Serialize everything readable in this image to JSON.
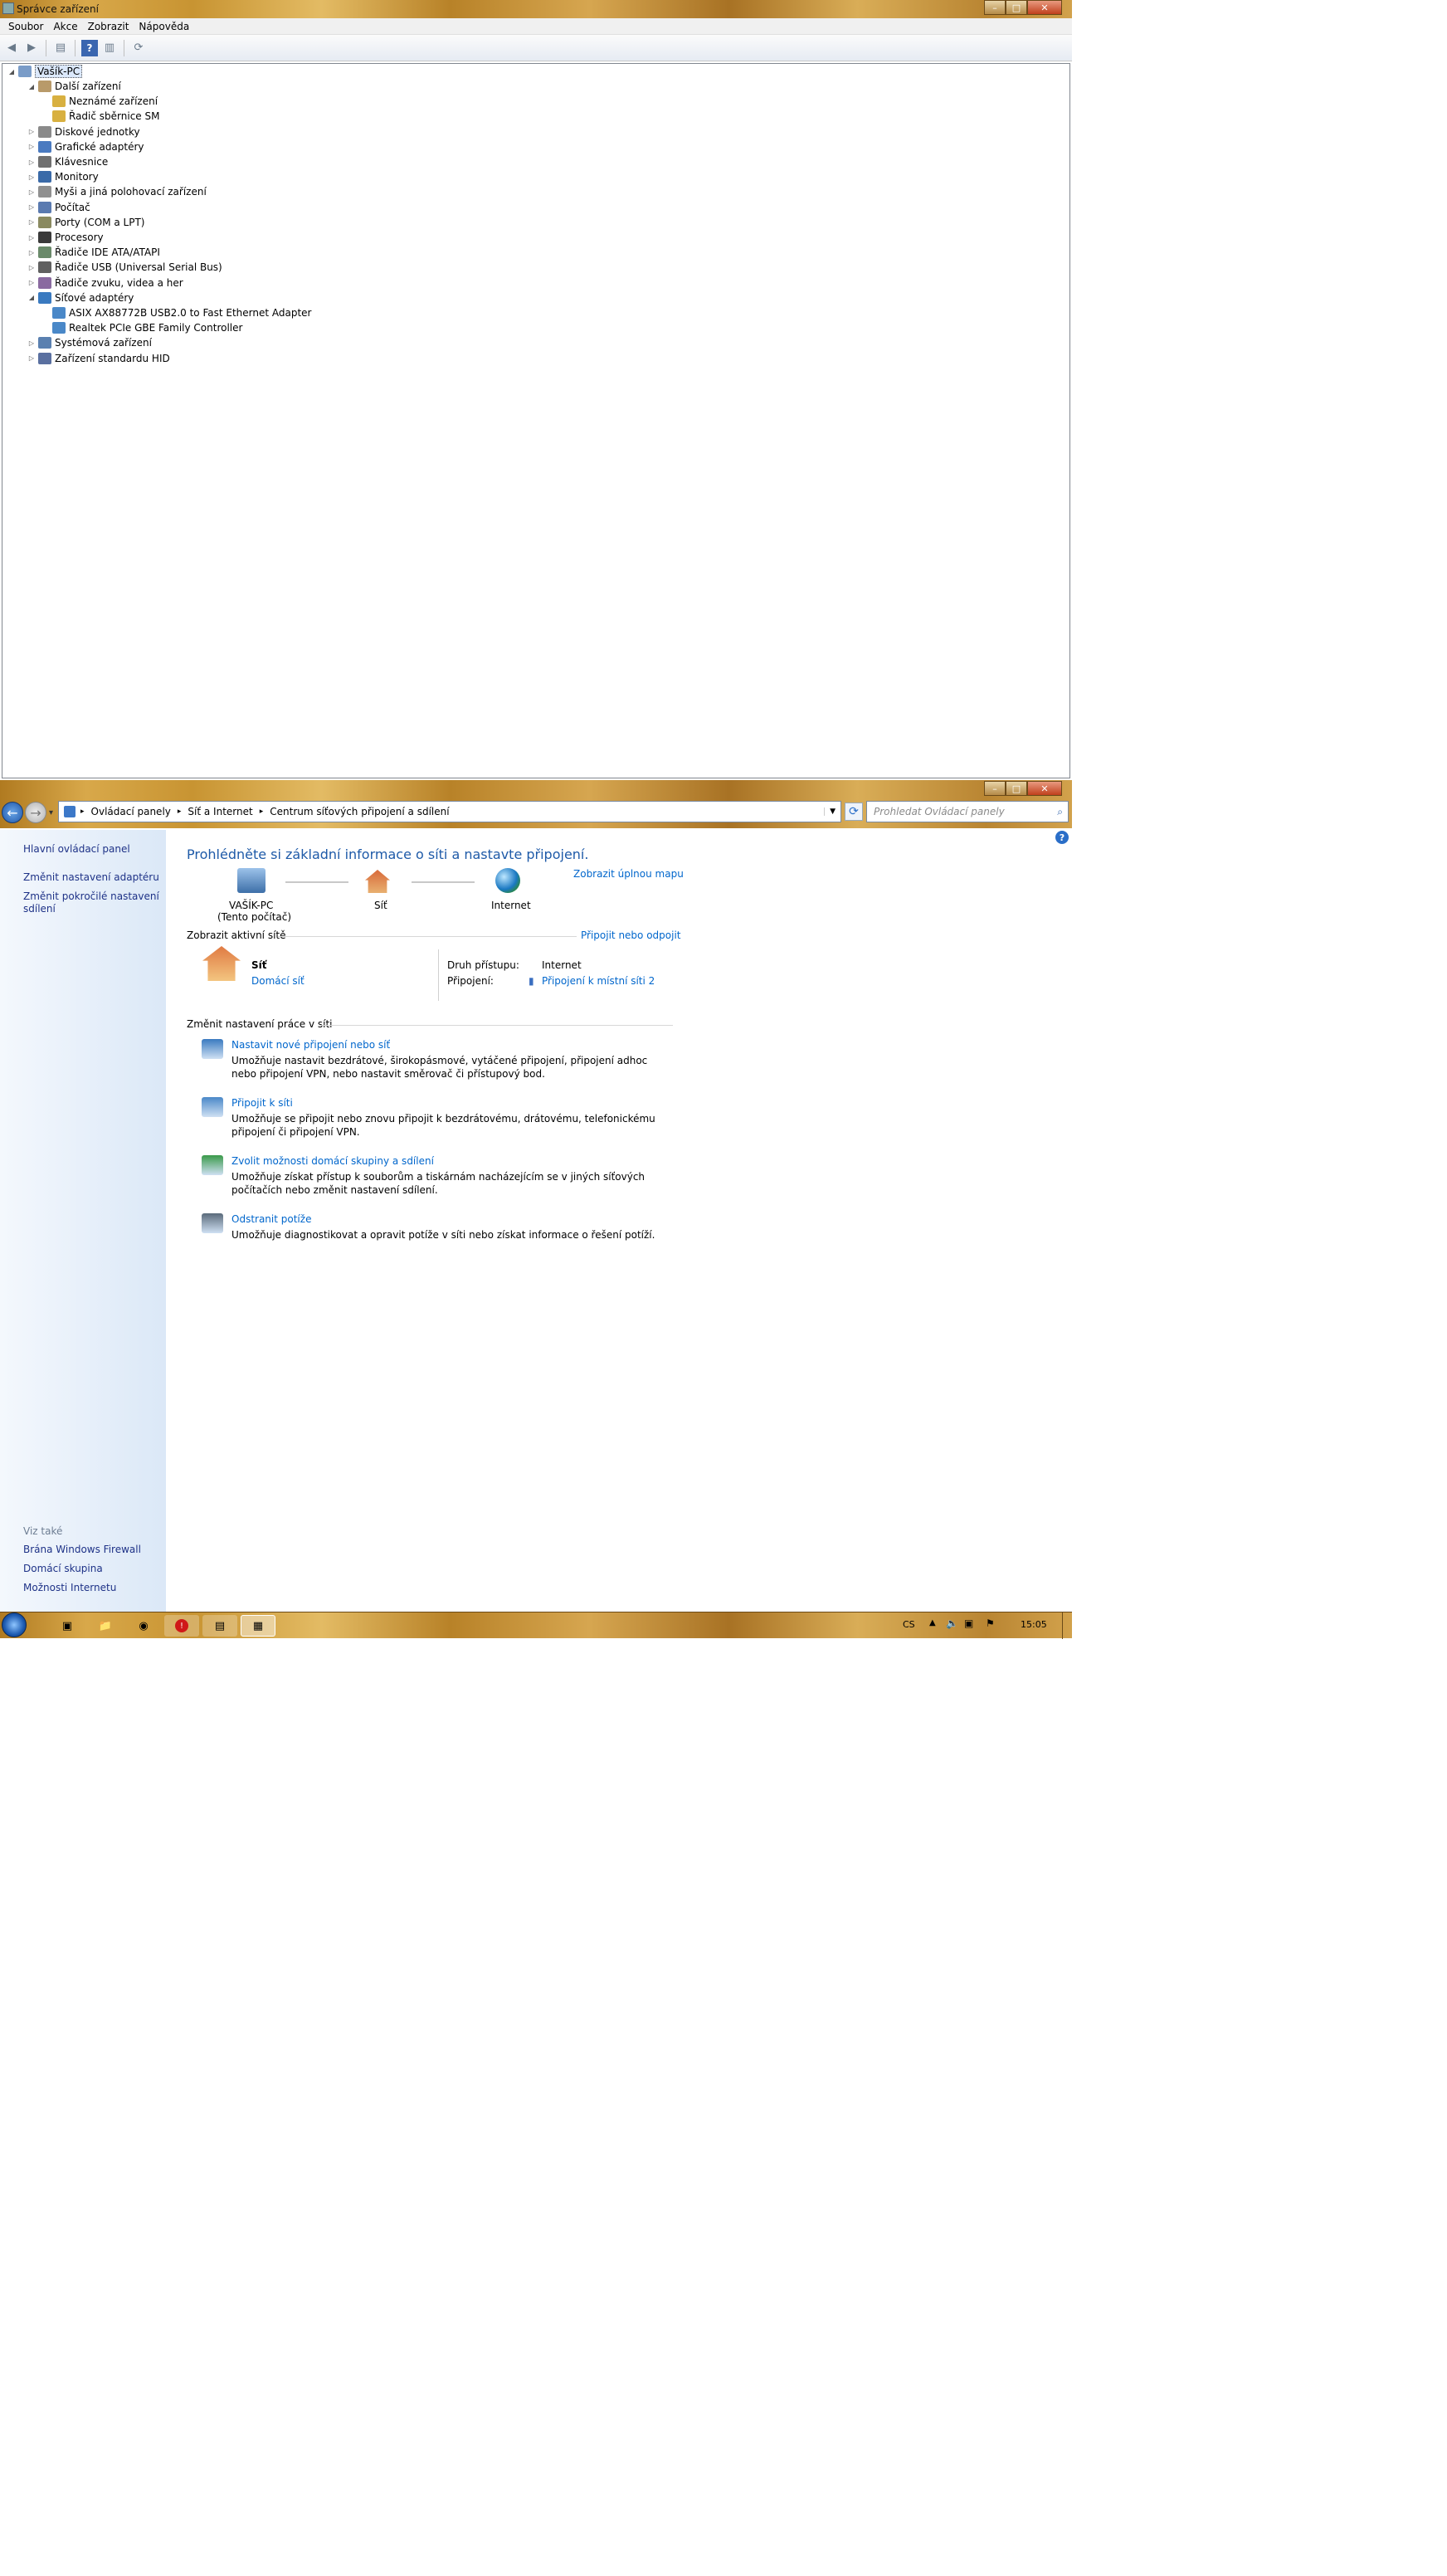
{
  "device_manager": {
    "title": "Správce zařízení",
    "caption_buttons": {
      "min": "–",
      "max": "□",
      "close": "✕"
    },
    "menu": [
      "Soubor",
      "Akce",
      "Zobrazit",
      "Nápověda"
    ],
    "toolbar_icons": [
      "back-arrow-icon",
      "forward-arrow-icon",
      "properties-icon",
      "help-icon",
      "console-tree-icon",
      "scan-hardware-icon"
    ],
    "tree": {
      "root": "Vašík-PC",
      "nodes": [
        {
          "label": "Další zařízení",
          "expanded": true,
          "children": [
            "Neznámé zařízení",
            "Řadič sběrnice SM"
          ]
        },
        {
          "label": "Diskové jednotky"
        },
        {
          "label": "Grafické adaptéry"
        },
        {
          "label": "Klávesnice"
        },
        {
          "label": "Monitory"
        },
        {
          "label": "Myši a jiná polohovací zařízení"
        },
        {
          "label": "Počítač"
        },
        {
          "label": "Porty (COM a LPT)"
        },
        {
          "label": "Procesory"
        },
        {
          "label": "Řadiče IDE ATA/ATAPI"
        },
        {
          "label": "Řadiče USB (Universal Serial Bus)"
        },
        {
          "label": "Řadiče zvuku, videa a her"
        },
        {
          "label": "Síťové adaptéry",
          "expanded": true,
          "children": [
            "ASIX AX88772B USB2.0 to Fast Ethernet Adapter",
            "Realtek PCIe GBE Family Controller"
          ]
        },
        {
          "label": "Systémová zařízení"
        },
        {
          "label": "Zařízení standardu HID"
        }
      ]
    }
  },
  "network_center": {
    "caption_buttons": {
      "min": "–",
      "max": "□",
      "close": "✕"
    },
    "nav": {
      "back": "←",
      "forward": "→",
      "recent": "▾"
    },
    "breadcrumb": [
      "Ovládací panely",
      "Síť a Internet",
      "Centrum síťových připojení a sdílení"
    ],
    "search_placeholder": "Prohledat Ovládací panely",
    "left_links": [
      "Hlavní ovládací panel",
      "Změnit nastavení adaptéru",
      "Změnit pokročilé nastavení sdílení"
    ],
    "see_also_heading": "Viz také",
    "see_also": [
      "Brána Windows Firewall",
      "Domácí skupina",
      "Možnosti Internetu"
    ],
    "heading": "Prohlédněte si základní informace o síti a nastavte připojení.",
    "full_map_link": "Zobrazit úplnou mapu",
    "map": {
      "computer": "VAŠÍK-PC",
      "computer_sub": "(Tento počítač)",
      "network": "Síť",
      "internet": "Internet"
    },
    "active_networks_label": "Zobrazit aktivní sítě",
    "connect_disconnect_link": "Připojit nebo odpojit",
    "active_network": {
      "name": "Síť",
      "type_link": "Domácí síť",
      "access_label": "Druh přístupu:",
      "access_value": "Internet",
      "connections_label": "Připojení:",
      "connections_link": "Připojení k místní síti 2"
    },
    "change_settings_label": "Změnit nastavení práce v síti",
    "tasks": [
      {
        "title": "Nastavit nové připojení nebo síť",
        "desc": "Umožňuje nastavit bezdrátové, širokopásmové, vytáčené připojení, připojení adhoc nebo připojení VPN, nebo nastavit směrovač či přístupový bod."
      },
      {
        "title": "Připojit k síti",
        "desc": "Umožňuje se připojit nebo znovu připojit k bezdrátovému, drátovému, telefonickému připojení či připojení VPN."
      },
      {
        "title": "Zvolit možnosti domácí skupiny a sdílení",
        "desc": "Umožňuje získat přístup k souborům a tiskárnám nacházejícím se v jiných síťových počítačích nebo změnit nastavení sdílení."
      },
      {
        "title": "Odstranit potíže",
        "desc": "Umožňuje diagnostikovat a opravit potíže v síti nebo získat informace o řešení potíží."
      }
    ]
  },
  "taskbar": {
    "language": "CS",
    "tray_icons": [
      "show-hidden-icons-icon",
      "volume-icon",
      "network-icon",
      "action-center-flag-icon"
    ],
    "clock": "15:05",
    "buttons": [
      "explorer-icon",
      "folder-icon",
      "chrome-icon",
      "antivirus-icon",
      "device-manager-icon",
      "network-center-icon"
    ]
  },
  "colors": {
    "link": "#0066cc",
    "heading": "#1e5aa8",
    "taskbar": "#c89432"
  }
}
